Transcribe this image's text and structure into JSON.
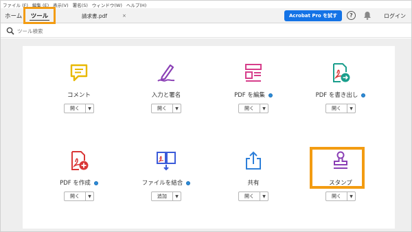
{
  "menu": [
    "ファイル (F)",
    "編集 (E)",
    "表示(V)",
    "署名(S)",
    "ウィンドウ(W)",
    "ヘルプ(H)"
  ],
  "tabs": {
    "home": "ホーム",
    "tools": "ツール",
    "document": "請求書.pdf",
    "close": "×"
  },
  "header": {
    "acrobat_button": "Acrobat Pro を試す",
    "help": "?",
    "login": "ログイン"
  },
  "search": {
    "placeholder": "ツール検索"
  },
  "tools": [
    {
      "label": "コメント",
      "button": "開く",
      "info": false
    },
    {
      "label": "入力と署名",
      "button": "開く",
      "info": false
    },
    {
      "label": "PDF を編集",
      "button": "開く",
      "info": true
    },
    {
      "label": "PDF を書き出し",
      "button": "開く",
      "info": true
    },
    {
      "label": "PDF を作成",
      "button": "開く",
      "info": true
    },
    {
      "label": "ファイルを結合",
      "button": "追加",
      "info": true
    },
    {
      "label": "共有",
      "button": "開く",
      "info": false
    },
    {
      "label": "スタンプ",
      "button": "開く",
      "info": false
    }
  ],
  "colors": {
    "highlight": "#f39c12",
    "accent_blue": "#1473e6",
    "comment_icon": "#e8b800",
    "sign_icon": "#8a3fb5",
    "edit_icon": "#d63d8a",
    "export_icon": "#1a9e8c",
    "create_icon": "#d93636",
    "combine_icon": "#3b5bd9",
    "share_icon": "#2d7fd9",
    "stamp_icon": "#8a3fb5"
  }
}
